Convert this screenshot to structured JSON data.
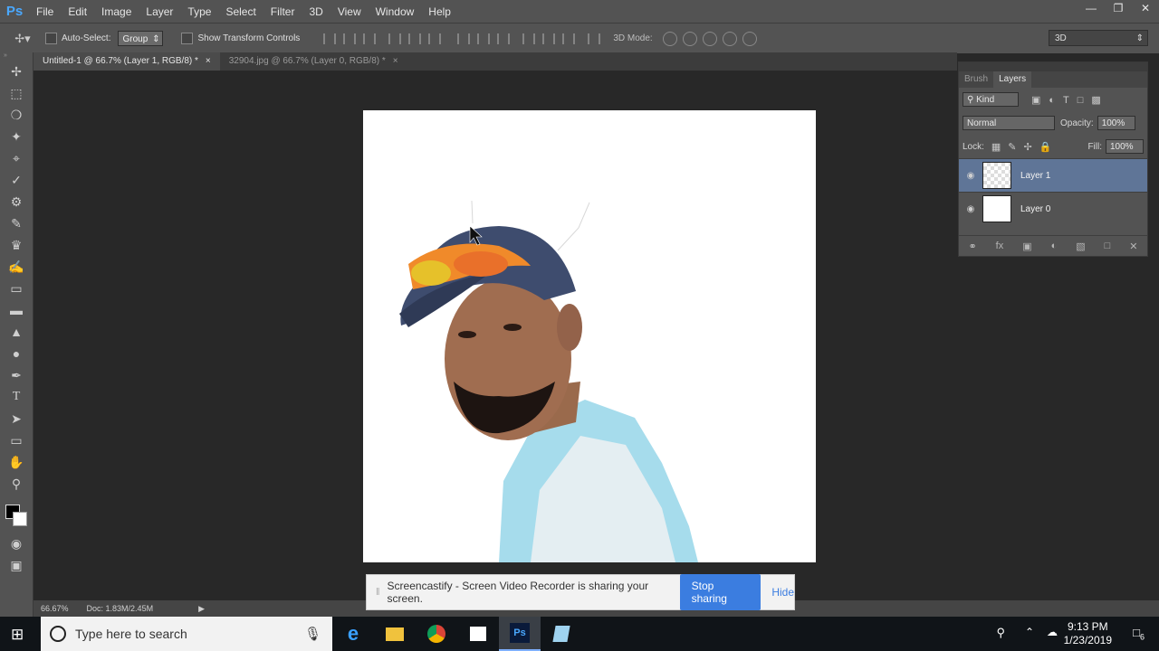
{
  "app": {
    "logo": "Ps"
  },
  "menu": [
    "File",
    "Edit",
    "Image",
    "Layer",
    "Type",
    "Select",
    "Filter",
    "3D",
    "View",
    "Window",
    "Help"
  ],
  "options": {
    "auto_select_label": "Auto-Select:",
    "auto_select_value": "Group",
    "transform_label": "Show Transform Controls",
    "mode_3d_label": "3D Mode:",
    "workspace": "3D"
  },
  "tabs": [
    {
      "label": "Untitled-1 @ 66.7% (Layer 1, RGB/8) *",
      "close": "×"
    },
    {
      "label": "32904.jpg @ 66.7% (Layer 0, RGB/8) *",
      "close": "×"
    }
  ],
  "layers_panel": {
    "tab_brush": "Brush",
    "tab_layers": "Layers",
    "kind": "Kind",
    "blend_mode": "Normal",
    "opacity_label": "Opacity:",
    "opacity_value": "100%",
    "lock_label": "Lock:",
    "fill_label": "Fill:",
    "fill_value": "100%",
    "layers": [
      {
        "name": "Layer 1"
      },
      {
        "name": "Layer 0"
      }
    ]
  },
  "status": {
    "zoom": "66.67%",
    "doc": "Doc: 1.83M/2.45M"
  },
  "castbar": {
    "message": "Screencastify - Screen Video Recorder is sharing your screen.",
    "stop_label": "Stop sharing",
    "hide_label": "Hide"
  },
  "taskbar": {
    "search_placeholder": "Type here to search",
    "time": "9:13 PM",
    "date": "1/23/2019",
    "notification_count": "6"
  },
  "colors": {
    "selected_layer": "#5f7597",
    "stop_button": "#3b7de0",
    "ps_blue": "#4aa8ff"
  }
}
